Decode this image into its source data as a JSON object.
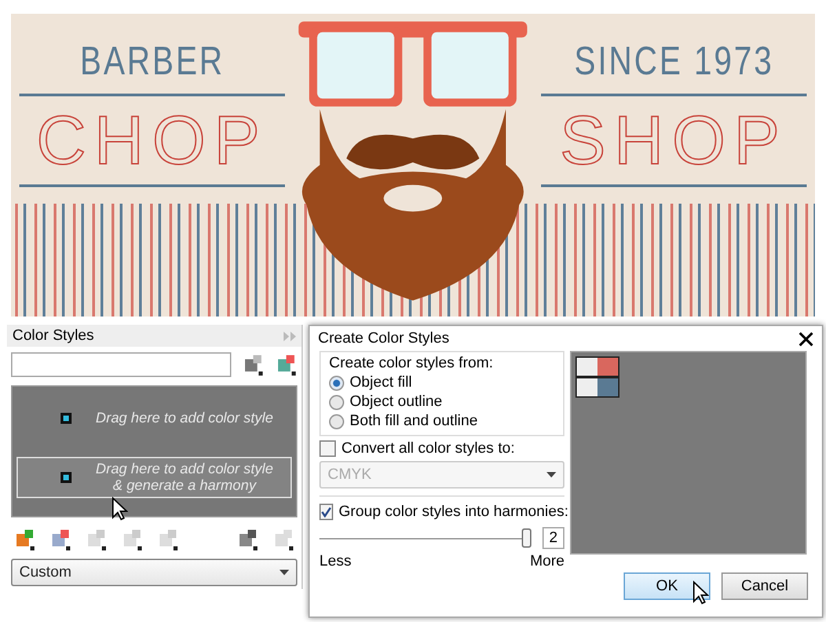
{
  "banner": {
    "top_left": "BARBER",
    "left_word": "CHOP",
    "top_right": "SINCE 1973",
    "right_word": "SHOP"
  },
  "color_styles_panel": {
    "title": "Color Styles",
    "drop_zones": [
      {
        "text": "Drag here to add color style",
        "highlighted": false
      },
      {
        "text": "Drag here to add color style & generate a harmony",
        "highlighted": true
      }
    ],
    "dropdown": {
      "value": "Custom"
    }
  },
  "dialog": {
    "title": "Create Color Styles",
    "source_group": {
      "label": "Create color styles from:",
      "options": [
        {
          "label": "Object fill",
          "selected": true
        },
        {
          "label": "Object outline",
          "selected": false
        },
        {
          "label": "Both fill and outline",
          "selected": false
        }
      ]
    },
    "convert": {
      "label": "Convert all color styles to:",
      "checked": false
    },
    "convert_dropdown": {
      "value": "CMYK",
      "disabled": true
    },
    "group": {
      "label": "Group color styles into harmonies:",
      "checked": true
    },
    "slider": {
      "level": 1,
      "value": "2",
      "min_label": "Less",
      "max_label": "More"
    },
    "swatches": [
      {
        "color": "#d9675e"
      },
      {
        "color": "#5a7a93"
      }
    ],
    "buttons": [
      {
        "label": "OK",
        "default": true
      },
      {
        "label": "Cancel",
        "default": false
      }
    ]
  }
}
